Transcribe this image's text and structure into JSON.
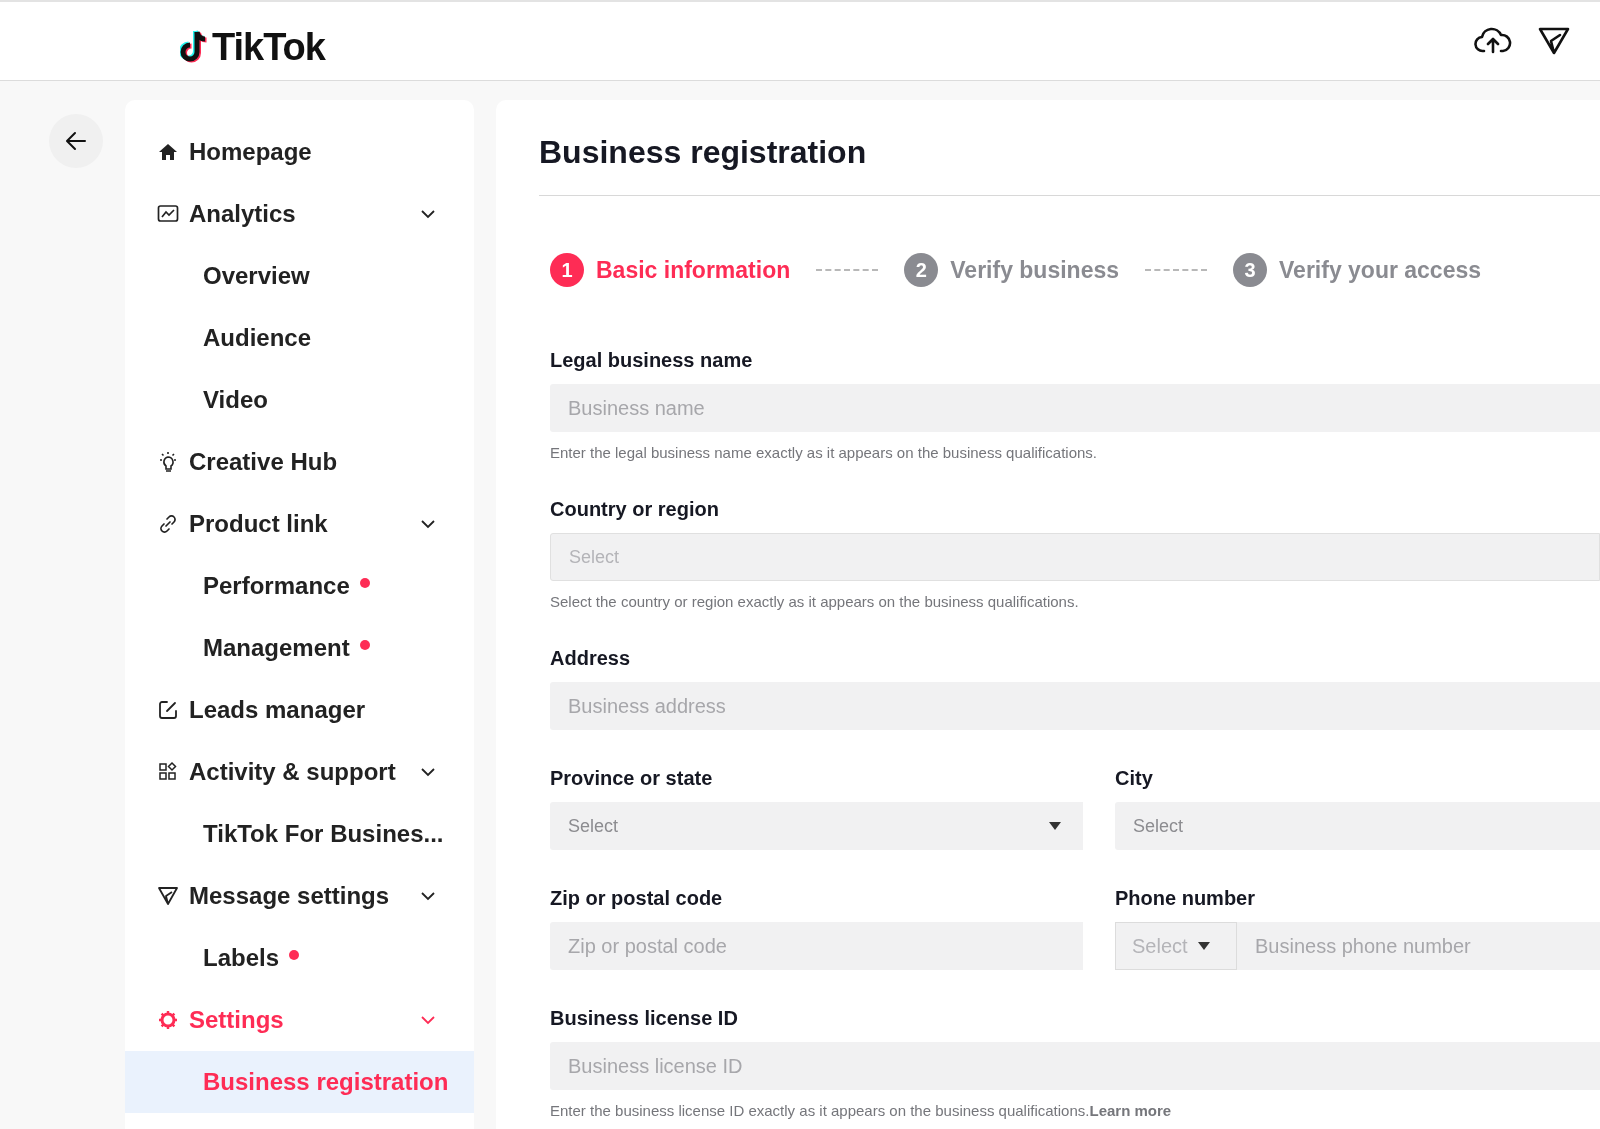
{
  "header": {
    "logo_text": "TikTok"
  },
  "sidebar": {
    "items": [
      {
        "label": "Homepage",
        "selected": false,
        "badge_dot": false
      },
      {
        "label": "Analytics",
        "selected": false,
        "badge_dot": false,
        "expanded": true,
        "children": [
          {
            "label": "Overview",
            "selected": false,
            "badge_dot": false
          },
          {
            "label": "Audience",
            "selected": false,
            "badge_dot": false
          },
          {
            "label": "Video",
            "selected": false,
            "badge_dot": false
          }
        ]
      },
      {
        "label": "Creative Hub",
        "selected": false,
        "badge_dot": false
      },
      {
        "label": "Product link",
        "selected": false,
        "badge_dot": false,
        "expanded": true,
        "children": [
          {
            "label": "Performance",
            "selected": false,
            "badge_dot": true
          },
          {
            "label": "Management",
            "selected": false,
            "badge_dot": true
          }
        ]
      },
      {
        "label": "Leads manager",
        "selected": false,
        "badge_dot": false
      },
      {
        "label": "Activity & support",
        "selected": false,
        "badge_dot": false,
        "expanded": true,
        "children": [
          {
            "label": "TikTok For Busines...",
            "selected": false,
            "badge_dot": false
          }
        ]
      },
      {
        "label": "Message settings",
        "selected": false,
        "badge_dot": false,
        "expanded": true,
        "children": [
          {
            "label": "Labels",
            "selected": false,
            "badge_dot": true
          }
        ]
      },
      {
        "label": "Settings",
        "selected": false,
        "badge_dot": false,
        "expanded": true,
        "children": [
          {
            "label": "Business registration",
            "selected": true,
            "badge_dot": false
          }
        ]
      }
    ]
  },
  "main": {
    "title": "Business registration",
    "steps": [
      {
        "number": "1",
        "label": "Basic information",
        "selected": true
      },
      {
        "number": "2",
        "label": "Verify business",
        "selected": false
      },
      {
        "number": "3",
        "label": "Verify your access",
        "selected": false
      }
    ],
    "form": {
      "rows": [
        [
          {
            "kind": "text",
            "label": "Legal business name",
            "placeholder": "Business name",
            "hint": "Enter the legal business name exactly as it appears on the business qualifications."
          }
        ],
        [
          {
            "kind": "select",
            "label": "Country or region",
            "placeholder": "Select",
            "disabled": true,
            "caret": false,
            "hint": "Select the country or region exactly as it appears on the business qualifications."
          }
        ],
        [
          {
            "kind": "text",
            "label": "Address",
            "placeholder": "Business address"
          }
        ],
        [
          {
            "kind": "select",
            "label": "Province or state",
            "placeholder": "Select",
            "disabled": false,
            "caret": true
          },
          {
            "kind": "select",
            "label": "City",
            "placeholder": "Select",
            "disabled": false,
            "caret": false
          }
        ],
        [
          {
            "kind": "text",
            "label": "Zip or postal code",
            "placeholder": "Zip or postal code"
          },
          {
            "kind": "phone",
            "label": "Phone number",
            "prefix_placeholder": "Select",
            "placeholder": "Business phone number"
          }
        ],
        [
          {
            "kind": "text",
            "label": "Business license ID",
            "placeholder": "Business license ID",
            "hint": "Enter the business license ID exactly as it appears on the business qualifications.",
            "link": "Learn more"
          }
        ]
      ]
    }
  }
}
